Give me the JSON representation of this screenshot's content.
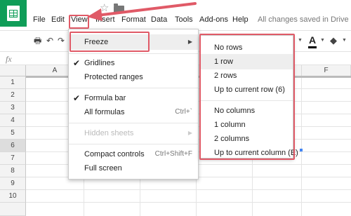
{
  "menubar": {
    "items": [
      "File",
      "Edit",
      "View",
      "Insert",
      "Format",
      "Data",
      "Tools",
      "Add-ons",
      "Help"
    ],
    "save_status": "All changes saved in Drive"
  },
  "icons": {
    "app": "sheets-app-icon",
    "star": "star-icon",
    "folder": "folder-icon"
  },
  "formula_bar": {
    "fx": "fx"
  },
  "grid": {
    "columns": [
      "A",
      "F"
    ],
    "rows": [
      "1",
      "2",
      "3",
      "4",
      "5",
      "6",
      "7",
      "8",
      "9",
      "10"
    ],
    "active_row": "6"
  },
  "view_menu": {
    "items": [
      {
        "label": "Freeze",
        "submenu": true,
        "highlighted": true
      },
      {
        "label": "Gridlines",
        "checked": true
      },
      {
        "label": "Protected ranges"
      },
      {
        "label": "Formula bar",
        "checked": true
      },
      {
        "label": "All formulas",
        "shortcut": "Ctrl+`"
      },
      {
        "label": "Hidden sheets",
        "submenu": true,
        "disabled": true
      },
      {
        "label": "Compact controls",
        "shortcut": "Ctrl+Shift+F"
      },
      {
        "label": "Full screen"
      }
    ]
  },
  "freeze_submenu": {
    "items": [
      {
        "label": "No rows"
      },
      {
        "label": "1 row",
        "highlighted": true
      },
      {
        "label": "2 rows"
      },
      {
        "label": "Up to current row (6)"
      },
      {
        "label": "No columns"
      },
      {
        "label": "1 column"
      },
      {
        "label": "2 columns"
      },
      {
        "label": "Up to current column (E)"
      }
    ]
  },
  "colors": {
    "annotation": "#e05a67",
    "brand": "#0f9d58"
  }
}
